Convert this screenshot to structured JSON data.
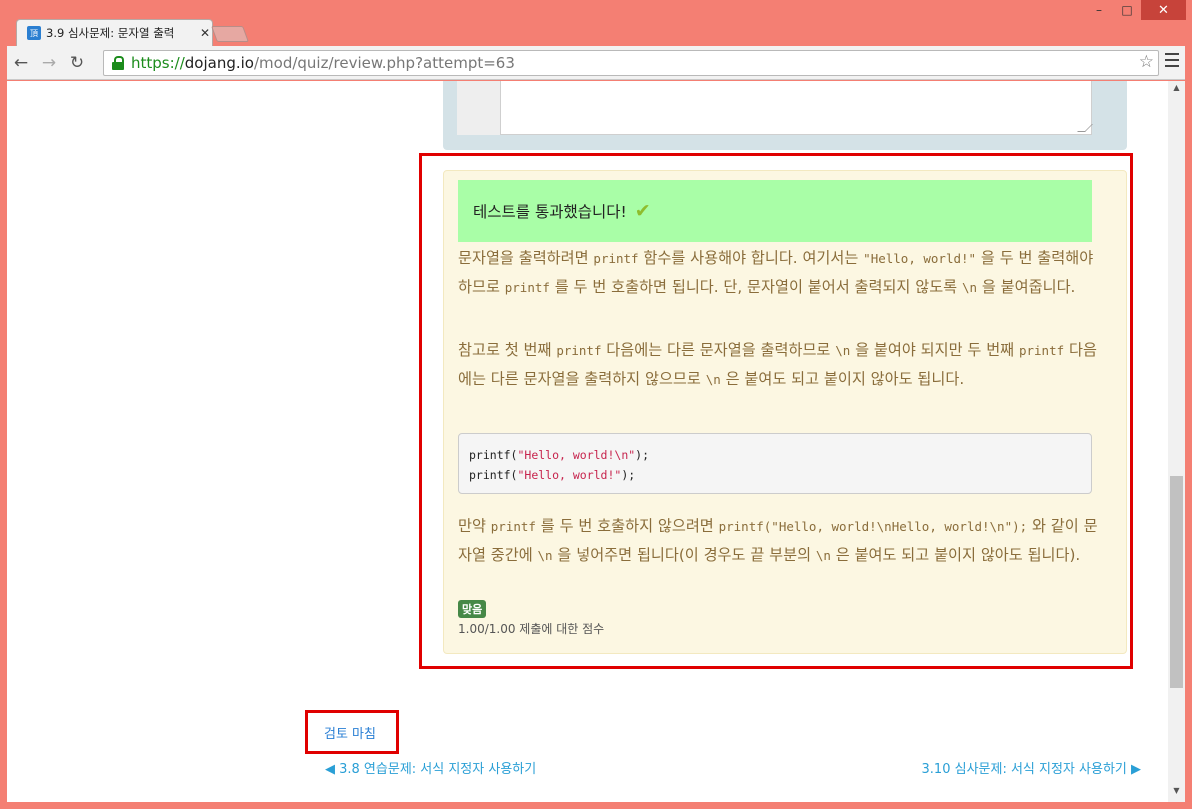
{
  "window": {
    "controls": {
      "minimize": "–",
      "maximize": "□",
      "close": "✕"
    }
  },
  "tab": {
    "favicon": "頂",
    "title": "3.9 심사문제: 문자열 출력",
    "close": "✕"
  },
  "toolbar": {
    "back": "←",
    "forward": "→",
    "reload": "↻",
    "url_scheme": "https://",
    "url_host": "dojang.io",
    "url_path": "/mod/quiz/review.php?attempt=63",
    "star": "☆"
  },
  "feedback": {
    "pass_message": "테스트를 통과했습니다!",
    "check": "✔",
    "p1": {
      "a": "문자열을 출력하려면 ",
      "code1": "printf",
      "b": " 함수를 사용해야 합니다. 여기서는 ",
      "code2": "\"Hello, world!\"",
      "c": " 을 두 번 출력해야 하므로 ",
      "code3": "printf",
      "d": " 를 두 번 호출하면 됩니다. 단, 문자열이 붙어서 출력되지 않도록 ",
      "code4": "\\n",
      "e": " 을 붙여줍니다."
    },
    "p2": {
      "a": "참고로 첫 번째 ",
      "code1": "printf",
      "b": " 다음에는 다른 문자열을 출력하므로 ",
      "code2": "\\n",
      "c": " 을 붙여야 되지만 두 번째 ",
      "code3": "printf",
      "d": " 다음에는 다른 문자열을 출력하지 않으므로 ",
      "code4": "\\n",
      "e": " 은 붙여도 되고 붙이지 않아도 됩니다."
    },
    "code_lines": [
      {
        "fn": "printf(",
        "str": "\"Hello, world!\\n\"",
        "end": ");"
      },
      {
        "fn": "printf(",
        "str": "\"Hello, world!\"",
        "end": ");"
      }
    ],
    "p4": {
      "a": "만약 ",
      "code1": "printf",
      "b": " 를 두 번 호출하지 않으려면 ",
      "code2": "printf(\"Hello, world!\\nHello, world!\\n\");",
      "c": " 와 같이 문자열 중간에 ",
      "code3": "\\n",
      "d": " 을 넣어주면 됩니다(이 경우도 끝 부분의 ",
      "code4": "\\n",
      "e": " 은 붙여도 되고 붙이지 않아도 됩니다)."
    },
    "badge": "맞음",
    "score": "1.00/1.00 제출에 대한 점수"
  },
  "footer": {
    "finish_review": "검토 마침",
    "prev_link": "◀ 3.8 연습문제: 서식 지정자 사용하기",
    "next_link": "3.10 심사문제: 서식 지정자 사용하기 ▶"
  },
  "colors": {
    "frame": "#f47f73",
    "pass_banner": "#a9fea7",
    "feedback_bg": "#fcf7e2",
    "feedback_text": "#8a6d3b",
    "correct_badge": "#468847",
    "link": "#2a9fd6",
    "highlight": "#e00000"
  }
}
